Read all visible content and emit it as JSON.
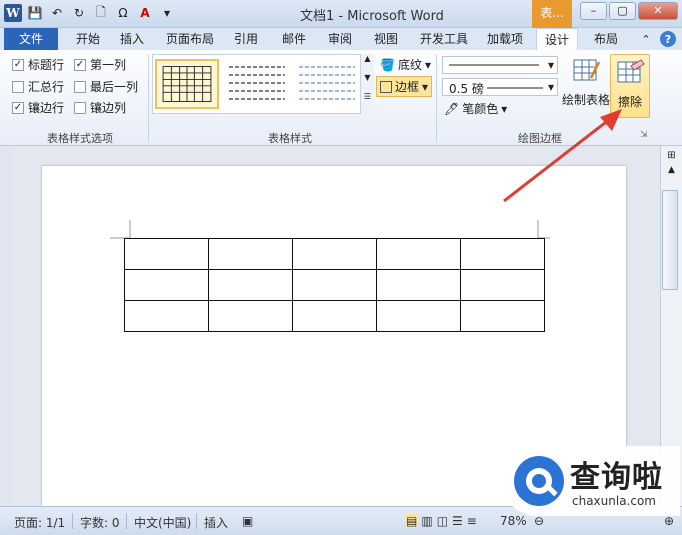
{
  "window": {
    "title": "文档1 - Microsoft Word",
    "context_tab_header": "表...",
    "min_label": "–",
    "max_label": "▢",
    "close_label": "✕"
  },
  "qat": {
    "word_logo": "W"
  },
  "tabs": [
    {
      "label": "文件",
      "kind": "file"
    },
    {
      "label": "开始"
    },
    {
      "label": "插入"
    },
    {
      "label": "页面布局"
    },
    {
      "label": "引用"
    },
    {
      "label": "邮件"
    },
    {
      "label": "审阅"
    },
    {
      "label": "视图"
    },
    {
      "label": "开发工具"
    },
    {
      "label": "加载项"
    },
    {
      "label": "设计",
      "active": true
    },
    {
      "label": "布局"
    }
  ],
  "ribbon": {
    "table_style_options": {
      "group_label": "表格样式选项",
      "items": [
        {
          "label": "标题行",
          "checked": true
        },
        {
          "label": "第一列",
          "checked": true
        },
        {
          "label": "汇总行",
          "checked": false
        },
        {
          "label": "最后一列",
          "checked": false
        },
        {
          "label": "镶边行",
          "checked": true
        },
        {
          "label": "镶边列",
          "checked": false
        }
      ]
    },
    "table_styles": {
      "group_label": "表格样式",
      "shading_label": "底纹",
      "borders_label": "边框"
    },
    "draw_borders": {
      "group_label": "绘图边框",
      "line_weight": "0.5 磅",
      "pen_color_label": "笔颜色",
      "draw_table_label": "绘制表格",
      "eraser_label": "擦除"
    }
  },
  "document": {
    "table": {
      "rows": 3,
      "cols": 5
    }
  },
  "status": {
    "page": "页面: 1/1",
    "words": "字数: 0",
    "language": "中文(中国)",
    "mode": "插入",
    "zoom": "78%"
  },
  "watermark": {
    "brand": "查询啦",
    "url": "chaxunla.com"
  },
  "colors": {
    "file_tab": "#2a65b8",
    "context_tab": "#e89a2f",
    "annotation_arrow": "#e03c32"
  }
}
